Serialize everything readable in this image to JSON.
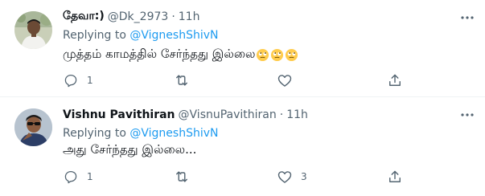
{
  "colors": {
    "accent": "#1d9bf0",
    "text_primary": "#0f1419",
    "text_secondary": "#536471",
    "divider": "#eff3f4"
  },
  "tweets": [
    {
      "display_name": "தேவா:)",
      "handle": "@Dk_2973",
      "separator": "·",
      "time": "11h",
      "replying_prefix": "Replying to",
      "replying_to": "@VigneshShivN",
      "text": "முத்தம் காமத்தில் சேர்ந்தது இல்லை",
      "emojis": [
        "face-with-rolling-eyes",
        "face-with-rolling-eyes",
        "face-with-rolling-eyes"
      ],
      "reply_count": "1",
      "retweet_count": "",
      "like_count": "",
      "icons": {
        "more": "more-dots-icon",
        "reply": "reply-icon",
        "retweet": "retweet-icon",
        "like": "like-icon",
        "share": "share-icon"
      }
    },
    {
      "display_name": "Vishnu Pavithiran",
      "handle": "@VisnuPavithiran",
      "separator": "·",
      "time": "11h",
      "replying_prefix": "Replying to",
      "replying_to": "@VigneshShivN",
      "text": "அது சேர்ந்தது இல்லை...",
      "reply_count": "1",
      "retweet_count": "",
      "like_count": "3",
      "icons": {
        "more": "more-dots-icon",
        "reply": "reply-icon",
        "retweet": "retweet-icon",
        "like": "like-icon",
        "share": "share-icon"
      }
    }
  ]
}
